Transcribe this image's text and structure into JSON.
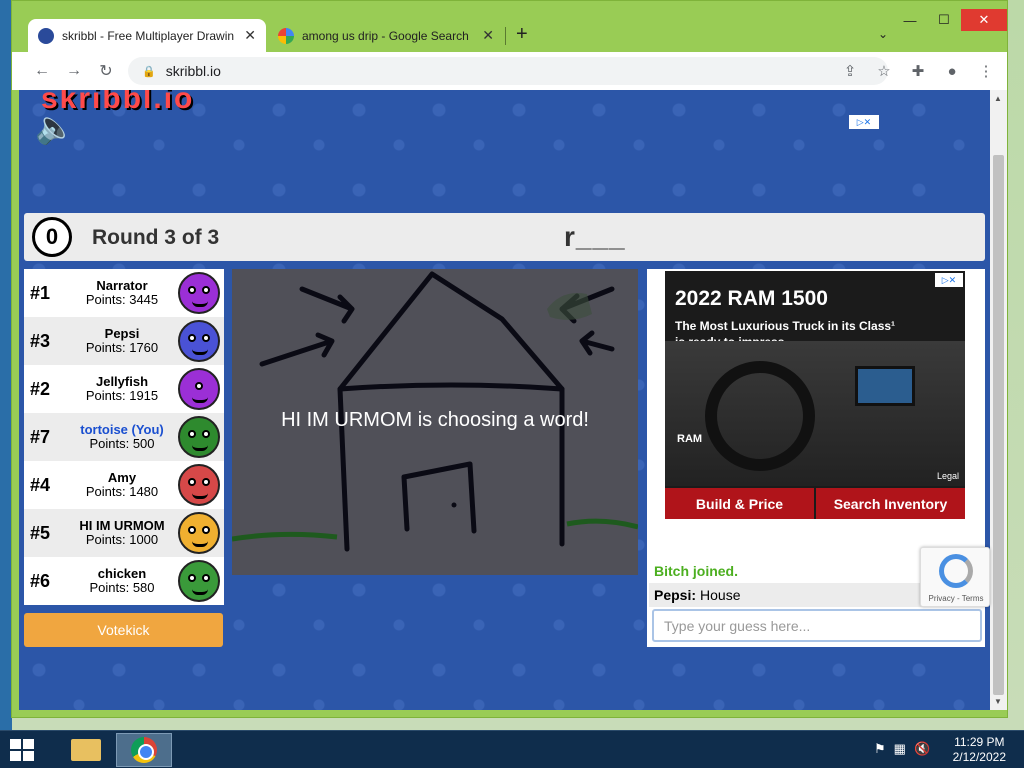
{
  "browser": {
    "tabs": [
      {
        "title": "skribbl - Free Multiplayer Drawin",
        "active": true
      },
      {
        "title": "among us drip - Google Search",
        "active": false
      }
    ],
    "url": "skribbl.io"
  },
  "game": {
    "timer": "0",
    "round": "Round 3 of 3",
    "word_hint": "r___",
    "status": "HI IM URMOM is choosing a word!",
    "players": [
      {
        "rank": "#1",
        "name": "Narrator",
        "points": "Points: 3445",
        "avatar_color": "#9b2fd6",
        "you": false
      },
      {
        "rank": "#3",
        "name": "Pepsi",
        "points": "Points: 1760",
        "avatar_color": "#4a52d6",
        "you": false
      },
      {
        "rank": "#2",
        "name": "Jellyfish",
        "points": "Points: 1915",
        "avatar_color": "#9b2fd6",
        "you": false
      },
      {
        "rank": "#7",
        "name": "tortoise (You)",
        "points": "Points: 500",
        "avatar_color": "#2e8a2e",
        "you": true
      },
      {
        "rank": "#4",
        "name": "Amy",
        "points": "Points: 1480",
        "avatar_color": "#d64848",
        "you": false
      },
      {
        "rank": "#5",
        "name": "HI IM URMOM",
        "points": "Points: 1000",
        "avatar_color": "#f0b030",
        "you": false
      },
      {
        "rank": "#6",
        "name": "chicken",
        "points": "Points: 580",
        "avatar_color": "#3a9a3a",
        "you": false
      }
    ],
    "votekick_label": "Votekick",
    "chat": [
      {
        "type": "system",
        "text": "Bitch joined."
      },
      {
        "type": "message",
        "user": "Pepsi:",
        "text": "House"
      }
    ],
    "guess_placeholder": "Type your guess here..."
  },
  "ad": {
    "title": "2022 RAM 1500",
    "line1": "The Most Luxurious Truck in its Class¹",
    "line2": "is ready to impress",
    "brand": "RAM",
    "legal": "Legal",
    "btn1": "Build & Price",
    "btn2": "Search Inventory"
  },
  "recaptcha": {
    "text": "Privacy - Terms"
  },
  "taskbar": {
    "time": "11:29 PM",
    "date": "2/12/2022"
  },
  "colors": {
    "accent_orange": "#f0a640",
    "chat_green": "#4caf20",
    "ad_red": "#b0141a",
    "page_blue": "#2c56a8"
  }
}
